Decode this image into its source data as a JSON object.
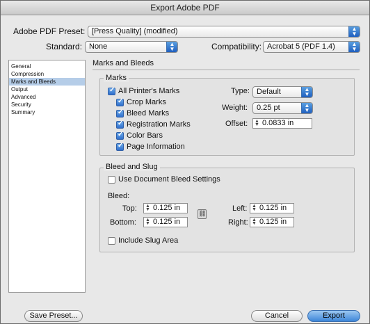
{
  "window": {
    "title": "Export Adobe PDF"
  },
  "preset": {
    "label": "Adobe PDF Preset:",
    "value": "[Press Quality] (modified)"
  },
  "standard": {
    "label": "Standard:",
    "value": "None"
  },
  "compatibility": {
    "label": "Compatibility:",
    "value": "Acrobat 5 (PDF 1.4)"
  },
  "sidebar": {
    "items": [
      {
        "label": "General"
      },
      {
        "label": "Compression"
      },
      {
        "label": "Marks and Bleeds"
      },
      {
        "label": "Output"
      },
      {
        "label": "Advanced"
      },
      {
        "label": "Security"
      },
      {
        "label": "Summary"
      }
    ],
    "selected": "Marks and Bleeds"
  },
  "pane": {
    "title": "Marks and Bleeds"
  },
  "marks": {
    "group_label": "Marks",
    "all_printers_marks": {
      "label": "All Printer's Marks",
      "checked": true
    },
    "crop_marks": {
      "label": "Crop Marks",
      "checked": true
    },
    "bleed_marks": {
      "label": "Bleed Marks",
      "checked": true
    },
    "registration_marks": {
      "label": "Registration Marks",
      "checked": true
    },
    "color_bars": {
      "label": "Color Bars",
      "checked": true
    },
    "page_information": {
      "label": "Page Information",
      "checked": true
    },
    "type": {
      "label": "Type:",
      "value": "Default"
    },
    "weight": {
      "label": "Weight:",
      "value": "0.25 pt"
    },
    "offset": {
      "label": "Offset:",
      "value": "0.0833 in"
    }
  },
  "bleed": {
    "group_label": "Bleed and Slug",
    "use_document": {
      "label": "Use Document Bleed Settings",
      "checked": false
    },
    "bleed_label": "Bleed:",
    "top": {
      "label": "Top:",
      "value": "0.125 in"
    },
    "bottom": {
      "label": "Bottom:",
      "value": "0.125 in"
    },
    "left": {
      "label": "Left:",
      "value": "0.125 in"
    },
    "right": {
      "label": "Right:",
      "value": "0.125 in"
    },
    "include_slug": {
      "label": "Include Slug Area",
      "checked": false
    }
  },
  "buttons": {
    "save_preset": "Save Preset...",
    "cancel": "Cancel",
    "export": "Export"
  }
}
